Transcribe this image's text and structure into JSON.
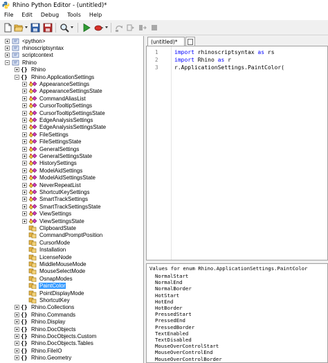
{
  "window": {
    "title": "Rhino Python Editor - (untitled)*"
  },
  "menu": [
    "File",
    "Edit",
    "Debug",
    "Tools",
    "Help"
  ],
  "toolbar": [
    "new-file-icon",
    "open-folder-icon",
    "save-icon",
    "save-as-icon",
    "find-icon",
    "run-icon",
    "debug-icon",
    "step-into-icon",
    "step-over-icon",
    "step-out-icon",
    "stop-icon"
  ],
  "tree": [
    {
      "label": "<python>",
      "depth": 0,
      "state": "plus",
      "icon": "module"
    },
    {
      "label": "rhinoscriptsyntax",
      "depth": 0,
      "state": "plus",
      "icon": "module"
    },
    {
      "label": "scriptcontext",
      "depth": 0,
      "state": "plus",
      "icon": "module"
    },
    {
      "label": "Rhino",
      "depth": 0,
      "state": "minus",
      "icon": "module"
    },
    {
      "label": "Rhino",
      "depth": 1,
      "state": "plus",
      "icon": "namespace"
    },
    {
      "label": "Rhino.ApplicationSettings",
      "depth": 1,
      "state": "minus",
      "icon": "namespace"
    },
    {
      "label": "AppearanceSettings",
      "depth": 2,
      "state": "plus",
      "icon": "class"
    },
    {
      "label": "AppearanceSettingsState",
      "depth": 2,
      "state": "plus",
      "icon": "class"
    },
    {
      "label": "CommandAliasList",
      "depth": 2,
      "state": "plus",
      "icon": "class"
    },
    {
      "label": "CursorTooltipSettings",
      "depth": 2,
      "state": "plus",
      "icon": "class"
    },
    {
      "label": "CursorTooltipSettingsState",
      "depth": 2,
      "state": "plus",
      "icon": "class"
    },
    {
      "label": "EdgeAnalysisSettings",
      "depth": 2,
      "state": "plus",
      "icon": "class"
    },
    {
      "label": "EdgeAnalysisSettingsState",
      "depth": 2,
      "state": "plus",
      "icon": "class"
    },
    {
      "label": "FileSettings",
      "depth": 2,
      "state": "plus",
      "icon": "class"
    },
    {
      "label": "FileSettingsState",
      "depth": 2,
      "state": "plus",
      "icon": "class"
    },
    {
      "label": "GeneralSettings",
      "depth": 2,
      "state": "plus",
      "icon": "class"
    },
    {
      "label": "GeneralSettingsState",
      "depth": 2,
      "state": "plus",
      "icon": "class"
    },
    {
      "label": "HistorySettings",
      "depth": 2,
      "state": "plus",
      "icon": "class"
    },
    {
      "label": "ModelAidSettings",
      "depth": 2,
      "state": "plus",
      "icon": "class"
    },
    {
      "label": "ModelAidSettingsState",
      "depth": 2,
      "state": "plus",
      "icon": "class"
    },
    {
      "label": "NeverRepeatList",
      "depth": 2,
      "state": "plus",
      "icon": "class"
    },
    {
      "label": "ShortcutKeySettings",
      "depth": 2,
      "state": "plus",
      "icon": "class"
    },
    {
      "label": "SmartTrackSettings",
      "depth": 2,
      "state": "plus",
      "icon": "class"
    },
    {
      "label": "SmartTrackSettingsState",
      "depth": 2,
      "state": "plus",
      "icon": "class"
    },
    {
      "label": "ViewSettings",
      "depth": 2,
      "state": "plus",
      "icon": "class"
    },
    {
      "label": "ViewSettingsState",
      "depth": 2,
      "state": "plus",
      "icon": "class"
    },
    {
      "label": "ClipboardState",
      "depth": 2,
      "state": "none",
      "icon": "enum"
    },
    {
      "label": "CommandPromptPosition",
      "depth": 2,
      "state": "none",
      "icon": "enum"
    },
    {
      "label": "CursorMode",
      "depth": 2,
      "state": "none",
      "icon": "enum"
    },
    {
      "label": "Installation",
      "depth": 2,
      "state": "none",
      "icon": "enum"
    },
    {
      "label": "LicenseNode",
      "depth": 2,
      "state": "none",
      "icon": "enum"
    },
    {
      "label": "MiddleMouseMode",
      "depth": 2,
      "state": "none",
      "icon": "enum"
    },
    {
      "label": "MouseSelectMode",
      "depth": 2,
      "state": "none",
      "icon": "enum"
    },
    {
      "label": "OsnapModes",
      "depth": 2,
      "state": "none",
      "icon": "enum"
    },
    {
      "label": "PaintColor",
      "depth": 2,
      "state": "none",
      "icon": "enum",
      "selected": true
    },
    {
      "label": "PointDisplayMode",
      "depth": 2,
      "state": "none",
      "icon": "enum"
    },
    {
      "label": "ShortcutKey",
      "depth": 2,
      "state": "none",
      "icon": "enum"
    },
    {
      "label": "Rhino.Collections",
      "depth": 1,
      "state": "plus",
      "icon": "namespace"
    },
    {
      "label": "Rhino.Commands",
      "depth": 1,
      "state": "plus",
      "icon": "namespace"
    },
    {
      "label": "Rhino.Display",
      "depth": 1,
      "state": "plus",
      "icon": "namespace"
    },
    {
      "label": "Rhino.DocObjects",
      "depth": 1,
      "state": "plus",
      "icon": "namespace"
    },
    {
      "label": "Rhino.DocObjects.Custom",
      "depth": 1,
      "state": "plus",
      "icon": "namespace"
    },
    {
      "label": "Rhino.DocObjects.Tables",
      "depth": 1,
      "state": "plus",
      "icon": "namespace"
    },
    {
      "label": "Rhino.FileIO",
      "depth": 1,
      "state": "plus",
      "icon": "namespace"
    },
    {
      "label": "Rhino.Geometry",
      "depth": 1,
      "state": "plus",
      "icon": "namespace"
    }
  ],
  "tabs": [
    {
      "label": "(untitled)*"
    },
    {
      "label": ""
    }
  ],
  "editor": {
    "line_numbers": [
      "1",
      "2",
      "3"
    ],
    "lines": [
      [
        {
          "t": "import",
          "kw": true
        },
        {
          "t": " rhinoscriptsyntax "
        },
        {
          "t": "as",
          "kw": true
        },
        {
          "t": " rs"
        }
      ],
      [
        {
          "t": "import",
          "kw": true
        },
        {
          "t": " Rhino "
        },
        {
          "t": "as",
          "kw": true
        },
        {
          "t": " r"
        }
      ],
      [
        {
          "t": "r.ApplicationSettings.PaintColor("
        }
      ]
    ]
  },
  "output": {
    "header": "Values for enum Rhino.ApplicationSettings.PaintColor",
    "values": [
      "NormalStart",
      "NormalEnd",
      "NormalBorder",
      "HotStart",
      "HotEnd",
      "HotBorder",
      "PressedStart",
      "PressedEnd",
      "PressedBorder",
      "TextEnabled",
      "TextDisabled",
      "MouseOverControlStart",
      "MouseOverControlEnd",
      "MouseOverControlBorder"
    ]
  },
  "colors": {
    "selection": "#3399ff",
    "keyword": "#0000ff",
    "line_number": "#808080",
    "namespace_braces": "#000000"
  }
}
